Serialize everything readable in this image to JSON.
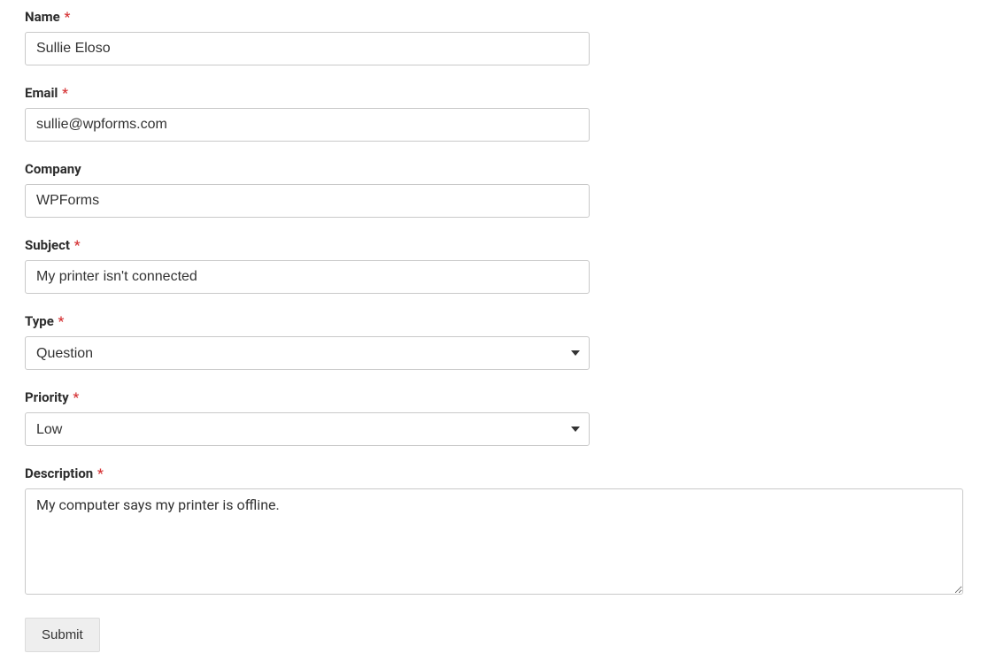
{
  "form": {
    "name": {
      "label": "Name",
      "required": true,
      "value": "Sullie Eloso"
    },
    "email": {
      "label": "Email",
      "required": true,
      "value": "sullie@wpforms.com"
    },
    "company": {
      "label": "Company",
      "required": false,
      "value": "WPForms"
    },
    "subject": {
      "label": "Subject",
      "required": true,
      "value": "My printer isn't connected"
    },
    "type": {
      "label": "Type",
      "required": true,
      "selected": "Question"
    },
    "priority": {
      "label": "Priority",
      "required": true,
      "selected": "Low"
    },
    "description": {
      "label": "Description",
      "required": true,
      "value": "My computer says my printer is offline."
    },
    "submit_label": "Submit",
    "required_mark": "*"
  }
}
